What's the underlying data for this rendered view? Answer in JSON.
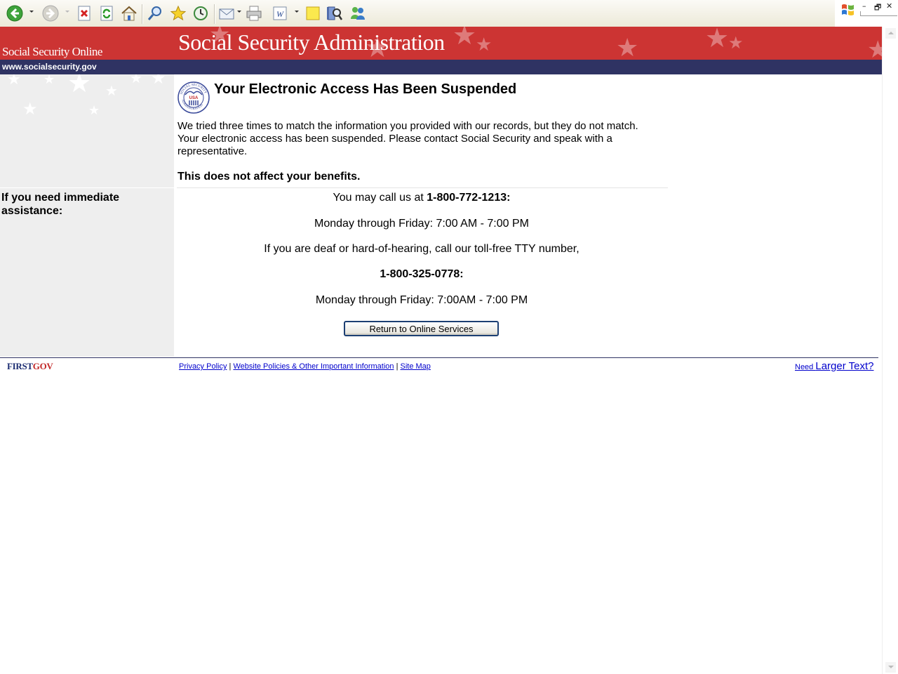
{
  "browser": {
    "toolbar": [
      {
        "name": "back-button",
        "icon": "back-arrow-icon"
      },
      {
        "name": "forward-button",
        "icon": "forward-arrow-icon"
      },
      {
        "name": "stop-button",
        "icon": "stop-icon"
      },
      {
        "name": "refresh-button",
        "icon": "refresh-icon"
      },
      {
        "name": "home-button",
        "icon": "home-icon"
      },
      {
        "name": "search-button",
        "icon": "magnifier-icon"
      },
      {
        "name": "favorites-button",
        "icon": "star-icon"
      },
      {
        "name": "history-button",
        "icon": "history-icon"
      },
      {
        "name": "mail-button",
        "icon": "envelope-icon"
      },
      {
        "name": "print-button",
        "icon": "printer-icon"
      },
      {
        "name": "edit-button",
        "icon": "word-document-icon"
      },
      {
        "name": "notes-button",
        "icon": "sticky-note-icon"
      },
      {
        "name": "research-button",
        "icon": "research-icon"
      },
      {
        "name": "messenger-button",
        "icon": "messenger-icon"
      }
    ],
    "window_controls": {
      "minimize": "–",
      "restore": "🗗",
      "close": "✕"
    }
  },
  "header": {
    "site_name": "Social Security Online",
    "agency_title": "Social Security Administration",
    "site_url": "www.socialsecurity.gov",
    "banner_color": "#cc3433",
    "urlbar_color": "#2f3363"
  },
  "sidebar": {
    "assist_heading": "If you need immediate assistance:"
  },
  "main": {
    "seal_text": {
      "top": "SOCIAL SECURITY",
      "center": "USA",
      "bottom": "ADMINISTRATION"
    },
    "heading": "Your Electronic Access Has Been Suspended",
    "message": "We tried three times to match the information you provided with our records, but they do not match. Your electronic access has been suspended. Please contact Social Security and speak with a representative.",
    "benefits_note": "This does not affect your benefits.",
    "call_prefix": "You may call us at ",
    "phone": "1-800-772-1213:",
    "hours_1": "Monday through Friday: 7:00 AM - 7:00 PM",
    "tty_line": "If you are deaf or hard-of-hearing, call our toll-free TTY number,",
    "tty_number": "1-800-325-0778:",
    "hours_2": "Monday through Friday: 7:00AM - 7:00 PM",
    "return_button": "Return to Online Services"
  },
  "footer": {
    "logo_first": "FIRST",
    "logo_gov": "GOV",
    "links": [
      "Privacy Policy",
      "Website Policies & Other Important Information",
      "Site Map"
    ],
    "separator": " | ",
    "larger_prefix": "Need ",
    "larger_link": "Larger Text?"
  }
}
